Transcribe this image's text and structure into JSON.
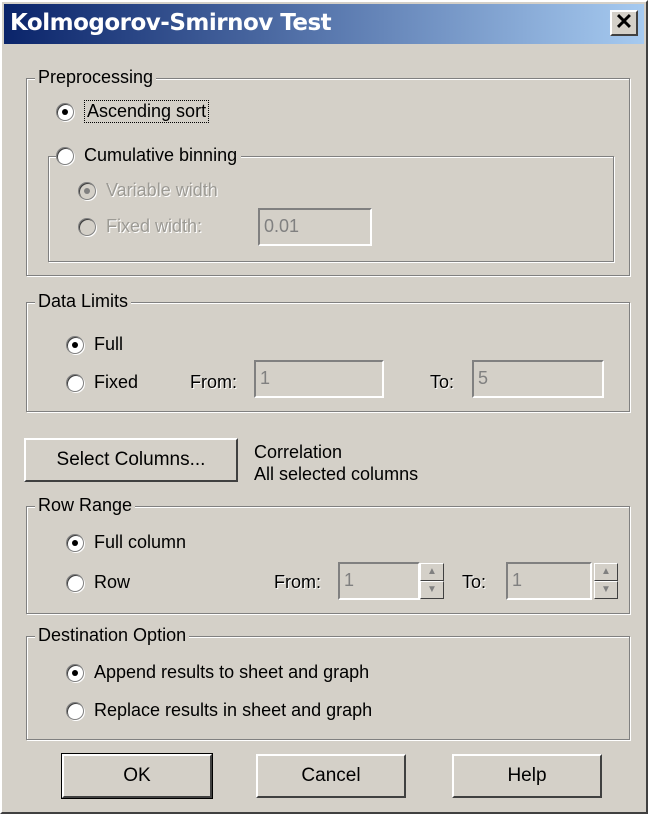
{
  "window": {
    "title": "Kolmogorov-Smirnov Test",
    "close_glyph": "✕"
  },
  "preprocessing": {
    "legend": "Preprocessing",
    "ascending_sort": "Ascending sort",
    "cumulative_binning": {
      "label": "Cumulative binning",
      "variable_width": "Variable width",
      "fixed_width": "Fixed width:",
      "fixed_width_value": "0.01"
    }
  },
  "data_limits": {
    "legend": "Data Limits",
    "full": "Full",
    "fixed": "Fixed",
    "from_label": "From:",
    "from_value": "1",
    "to_label": "To:",
    "to_value": "5"
  },
  "select_columns": {
    "button": "Select Columns...",
    "info_line1": "Correlation",
    "info_line2": "All selected columns"
  },
  "row_range": {
    "legend": "Row Range",
    "full_column": "Full column",
    "row": "Row",
    "from_label": "From:",
    "from_value": "1",
    "to_label": "To:",
    "to_value": "1"
  },
  "destination": {
    "legend": "Destination Option",
    "append": "Append results to sheet and graph",
    "replace": "Replace results in sheet and graph"
  },
  "buttons": {
    "ok": "OK",
    "cancel": "Cancel",
    "help": "Help"
  }
}
